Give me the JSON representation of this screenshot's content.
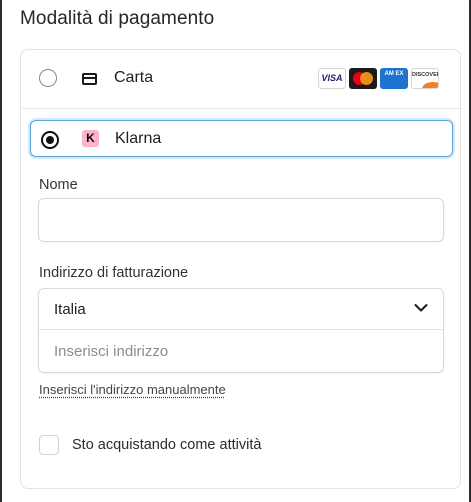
{
  "section": {
    "title": "Modalità di pagamento"
  },
  "methods": {
    "card": {
      "label": "Carta",
      "selected": false,
      "icon": "credit-card-icon",
      "brands": [
        "VISA",
        "Mastercard",
        "AMEX",
        "DISCOVER"
      ],
      "brand_short": {
        "visa": "VISA",
        "amex": "AM EX",
        "discover": "DISCOVER"
      }
    },
    "klarna": {
      "label": "Klarna",
      "selected": true,
      "logo_letter": "K"
    }
  },
  "form": {
    "name_label": "Nome",
    "name_value": "",
    "address_label": "Indirizzo di fatturazione",
    "country_value": "Italia",
    "address_placeholder": "Inserisci indirizzo",
    "manual_link": "Inserisci l'indirizzo manualmente",
    "business_checkbox_label": "Sto acquistando come attività",
    "business_checked": false
  },
  "colors": {
    "accent_focus": "#5ba5d9",
    "klarna_pink": "#ffb3c7",
    "text": "#1f1f1f",
    "placeholder": "#8c8c8c"
  }
}
